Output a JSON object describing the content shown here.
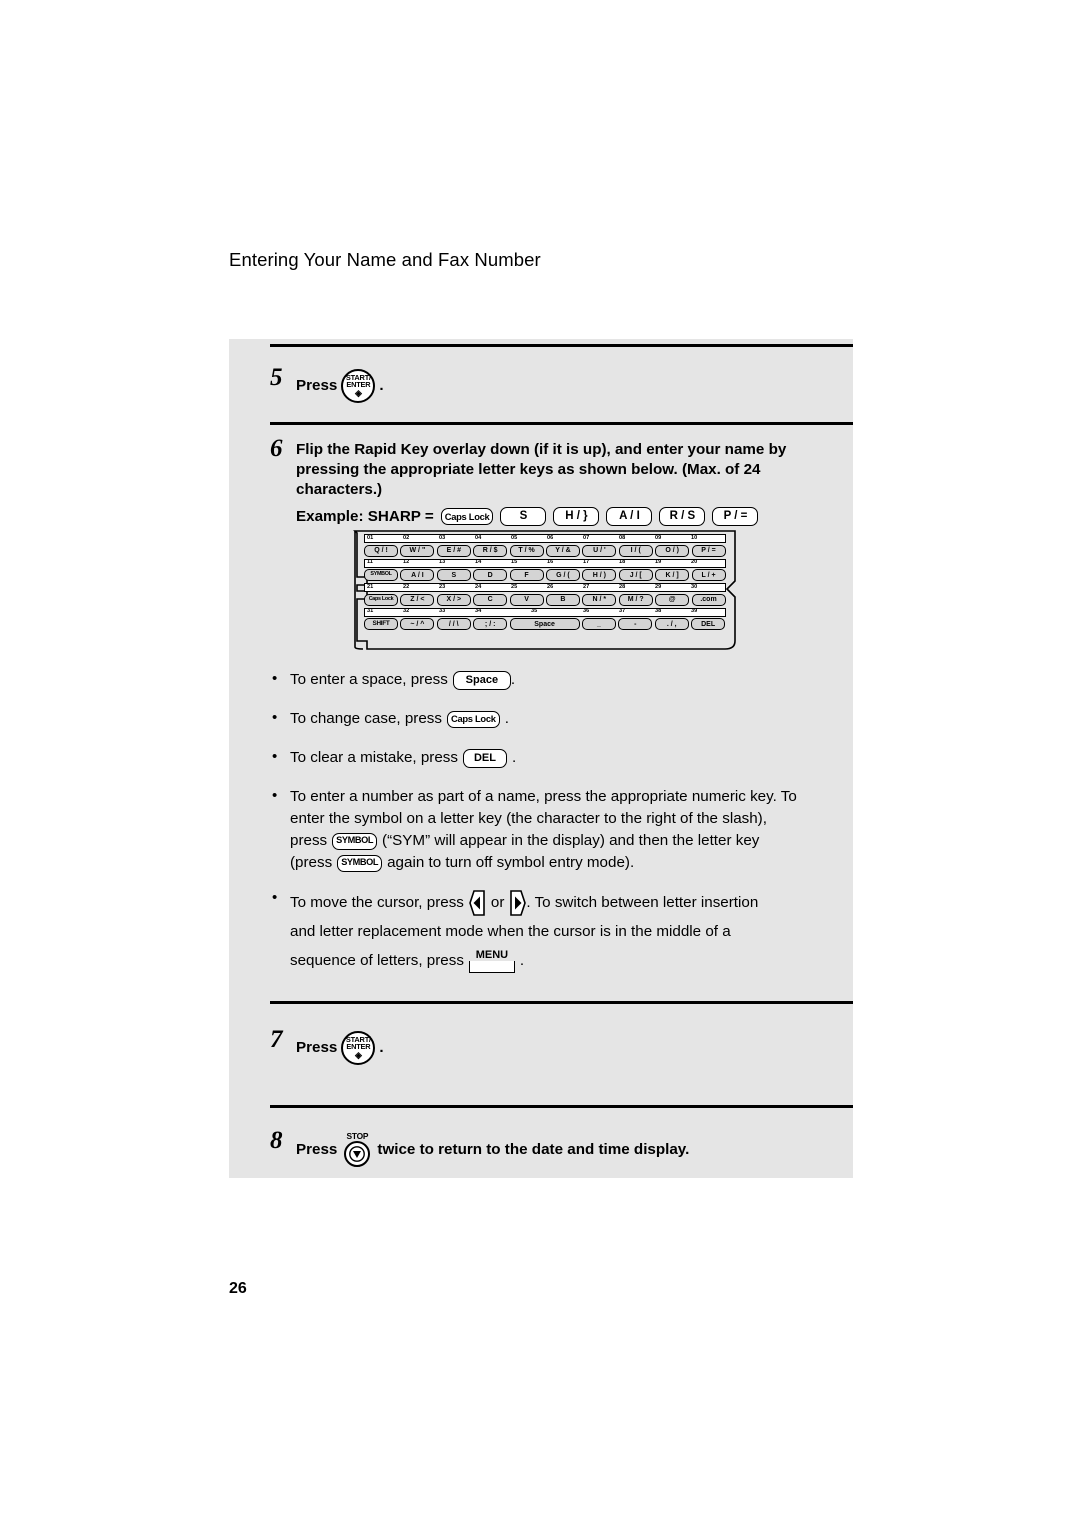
{
  "page": {
    "header": "Entering Your Name and Fax Number",
    "number": "26",
    "bg": "#ffffff",
    "panel_bg": "#e5e5e5",
    "key_fill": "#d4d4d4"
  },
  "steps": [
    {
      "num": "5",
      "text_before": "Press",
      "key": {
        "line1": "START/",
        "line2": "ENTER",
        "glyph": "◈"
      },
      "text_after": "."
    },
    {
      "num": "6",
      "paragraph_line1": "Flip the Rapid Key overlay down (if it is up), and enter your name by",
      "paragraph_line2": "pressing the appropriate letter keys as shown below. (Max. of 24",
      "paragraph_line3": "characters.)",
      "example_label": "Example: SHARP =",
      "example_keys": [
        "Caps Lock",
        "S",
        "H / }",
        "A / I",
        "R / S",
        "P / ="
      ]
    },
    {
      "num": "7",
      "text_before": "Press",
      "key": {
        "line1": "START/",
        "line2": "ENTER",
        "glyph": "◈"
      },
      "text_after": "."
    },
    {
      "num": "8",
      "text_before": "Press",
      "key": {
        "caption": "STOP",
        "icon": "stop-icon"
      },
      "text_after": "twice to return to the date and time display."
    }
  ],
  "keyboard_overlay": {
    "rows": [
      {
        "numbers": [
          "01",
          "02",
          "03",
          "04",
          "05",
          "06",
          "07",
          "08",
          "09",
          "10"
        ],
        "keys": [
          "Q / !",
          "W / \"",
          "E / #",
          "R / $",
          "T / %",
          "Y / &",
          "U / '",
          "I / (",
          "O / )",
          "P / ="
        ]
      },
      {
        "numbers": [
          "11",
          "12",
          "13",
          "14",
          "15",
          "16",
          "17",
          "18",
          "19",
          "20"
        ],
        "keys": [
          "SYMBOL",
          "A / I",
          "S",
          "D",
          "F",
          "G / (",
          "H / )",
          "J / [",
          "K / ]",
          "L / +"
        ]
      },
      {
        "numbers": [
          "21",
          "22",
          "23",
          "24",
          "25",
          "26",
          "27",
          "28",
          "29",
          "30"
        ],
        "keys": [
          "Caps Lock",
          "Z / <",
          "X / >",
          "C",
          "V",
          "B",
          "N / *",
          "M / ?",
          "@",
          ".com"
        ]
      },
      {
        "numbers": [
          "31",
          "32",
          "33",
          "34",
          "35",
          "36",
          "37",
          "38",
          "39"
        ],
        "keys": [
          "SHIFT",
          "~ / ^",
          "/ / \\",
          "; / :",
          "Space",
          "_",
          "-",
          ". / ,",
          "DEL"
        ]
      }
    ]
  },
  "bullets": [
    {
      "id": "space-bullet",
      "dot": "•",
      "pre": "To enter a space, press",
      "key": "Space",
      "post": "."
    },
    {
      "id": "caps-bullet",
      "dot": "•",
      "pre": "To change case, press",
      "key": "Caps Lock",
      "post": "."
    },
    {
      "id": "del-bullet",
      "dot": "•",
      "pre": "To clear a mistake, press",
      "key": "DEL",
      "post": "."
    },
    {
      "id": "symbol-bullet",
      "dot": "•",
      "line1": "To enter a number as part of a name, press the appropriate numeric key. To",
      "line2": "enter the symbol on a letter key (the character to the right of the slash),",
      "line3_a": "press",
      "line3_key": "SYMBOL",
      "line3_b": "(“SYM” will appear in the display) and then the letter key",
      "line4_a": "(press",
      "line4_key": "SYMBOL",
      "line4_b": "again to turn off symbol entry mode)."
    },
    {
      "id": "cursor-bullet",
      "dot": "•",
      "line1_a": "To move the cursor, press",
      "line1_or": "or",
      "line1_b": ". To switch between letter insertion",
      "line2": "and letter replacement mode when the cursor is in the middle of a",
      "line3_a": "sequence of letters, press",
      "line3_key": "MENU",
      "line3_b": "."
    }
  ]
}
